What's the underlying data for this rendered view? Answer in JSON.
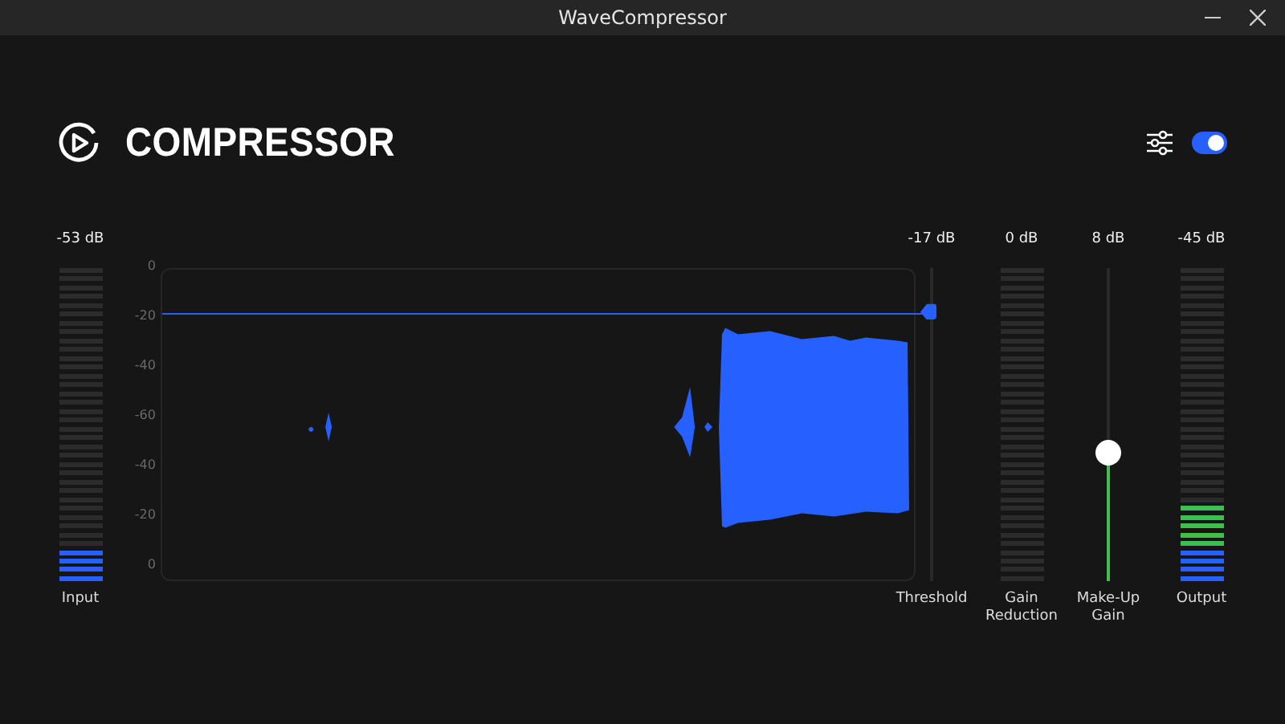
{
  "window": {
    "title": "WaveCompressor"
  },
  "header": {
    "title": "COMPRESSOR",
    "toggle": {
      "on": true
    }
  },
  "input_meter": {
    "reading": "-53 dB",
    "level": 0.11,
    "label": "Input"
  },
  "graph": {
    "axis_labels": [
      "0",
      "-20",
      "-40",
      "-60",
      "-40",
      "-20",
      "0"
    ]
  },
  "threshold": {
    "reading": "-17 dB",
    "level": 0.86,
    "label": "Threshold"
  },
  "gain_reduction_meter": {
    "reading": "0 dB",
    "label": "Gain Reduction"
  },
  "makeup_gain": {
    "reading": "8 dB",
    "level": 0.41,
    "label": "Make-Up Gain"
  },
  "output_meter": {
    "reading": "-45 dB",
    "level": 0.25,
    "label": "Output"
  }
}
